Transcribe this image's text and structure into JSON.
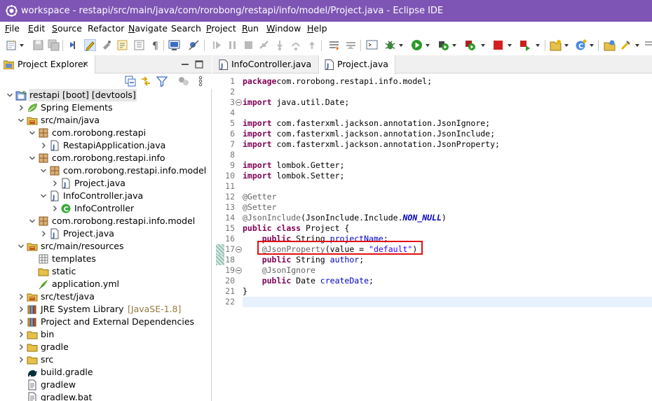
{
  "window": {
    "title": "workspace - restapi/src/main/java/com/rorobong/restapi/info/model/Project.java - Eclipse IDE"
  },
  "menu": [
    {
      "label": "File",
      "mnemonic": "F",
      "rest": "ile"
    },
    {
      "label": "Edit",
      "mnemonic": "E",
      "rest": "dit"
    },
    {
      "label": "Source",
      "mnemonic": "S",
      "rest": "ource"
    },
    {
      "label": "Refactor",
      "mnemonic": "",
      "rest": "Refactor"
    },
    {
      "label": "Navigate",
      "mnemonic": "N",
      "rest": "avigate"
    },
    {
      "label": "Search",
      "mnemonic": "",
      "rest": "Search"
    },
    {
      "label": "Project",
      "mnemonic": "P",
      "rest": "roject"
    },
    {
      "label": "Run",
      "mnemonic": "R",
      "rest": "un"
    },
    {
      "label": "Window",
      "mnemonic": "W",
      "rest": "indow"
    },
    {
      "label": "Help",
      "mnemonic": "H",
      "rest": "elp"
    }
  ],
  "explorer": {
    "tab_label": "Project Explorer",
    "tab_close": "✕",
    "tree": [
      {
        "label": "restapi [boot] [devtools]",
        "icon": "project-icon",
        "expanded": true,
        "selected": true
      },
      {
        "label": "Spring Elements",
        "icon": "spring-icon",
        "expanded": false
      },
      {
        "label": "src/main/java",
        "icon": "source-folder-icon",
        "expanded": true
      },
      {
        "label": "com.rorobong.restapi",
        "icon": "package-icon",
        "expanded": true
      },
      {
        "label": "RestapiApplication.java",
        "icon": "java-file-icon",
        "expanded": false
      },
      {
        "label": "com.rorobong.restapi.info",
        "icon": "package-icon",
        "expanded": true
      },
      {
        "label": "com.rorobong.restapi.info.model",
        "icon": "package-icon",
        "expanded": true
      },
      {
        "label": "Project.java",
        "icon": "java-file-icon",
        "expanded": false
      },
      {
        "label": "InfoController.java",
        "icon": "java-file-icon",
        "expanded": true
      },
      {
        "label": "InfoController",
        "icon": "class-icon",
        "expanded": false
      },
      {
        "label": "com.rorobong.restapi.info.model",
        "icon": "package-icon",
        "expanded": true
      },
      {
        "label": "Project.java",
        "icon": "java-file-icon",
        "expanded": false
      },
      {
        "label": "src/main/resources",
        "icon": "source-folder-icon",
        "expanded": true
      },
      {
        "label": "templates",
        "icon": "folder-grid-icon",
        "expanded": null
      },
      {
        "label": "static",
        "icon": "folder-icon",
        "expanded": null
      },
      {
        "label": "application.yml",
        "icon": "yaml-file-icon",
        "expanded": null
      },
      {
        "label": "src/test/java",
        "icon": "source-folder-icon",
        "expanded": false
      },
      {
        "label": "JRE System Library",
        "decoration": "[JavaSE-1.8]",
        "icon": "library-icon",
        "expanded": false
      },
      {
        "label": "Project and External Dependencies",
        "icon": "library-icon",
        "expanded": false
      },
      {
        "label": "bin",
        "icon": "folder-icon",
        "expanded": false
      },
      {
        "label": "gradle",
        "icon": "folder-icon",
        "expanded": false
      },
      {
        "label": "src",
        "icon": "folder-icon",
        "expanded": false
      },
      {
        "label": "build.gradle",
        "icon": "gradle-icon",
        "expanded": null
      },
      {
        "label": "gradlew",
        "icon": "text-file-icon",
        "expanded": null
      },
      {
        "label": "gradlew.bat",
        "icon": "text-file-icon",
        "expanded": null
      }
    ]
  },
  "editor": {
    "tabs": [
      {
        "label": "InfoController.java",
        "active": false
      },
      {
        "label": "Project.java",
        "active": true
      }
    ],
    "current_line": 22,
    "changed_lines": [
      17,
      18
    ],
    "folded_lines": [
      3,
      17,
      19
    ],
    "lines": [
      {
        "n": "1",
        "tokens": [
          [
            "kw",
            "package"
          ],
          [
            "",
            "com.rorobong.restapi.info.model;"
          ]
        ]
      },
      {
        "n": "2",
        "tokens": []
      },
      {
        "n": "3",
        "tokens": [
          [
            "kw",
            "import"
          ],
          [
            "",
            " java.util.Date;"
          ]
        ]
      },
      {
        "n": "4",
        "tokens": []
      },
      {
        "n": "5",
        "tokens": [
          [
            "kw",
            "import"
          ],
          [
            "",
            " com.fasterxml.jackson.annotation.JsonIgnore;"
          ]
        ]
      },
      {
        "n": "6",
        "tokens": [
          [
            "kw",
            "import"
          ],
          [
            "",
            " com.fasterxml.jackson.annotation.JsonInclude;"
          ]
        ]
      },
      {
        "n": "7",
        "tokens": [
          [
            "kw",
            "import"
          ],
          [
            "",
            " com.fasterxml.jackson.annotation.JsonProperty;"
          ]
        ]
      },
      {
        "n": "8",
        "tokens": []
      },
      {
        "n": "9",
        "tokens": [
          [
            "kw",
            "import"
          ],
          [
            "",
            " lombok.Getter;"
          ]
        ]
      },
      {
        "n": "10",
        "tokens": [
          [
            "kw",
            "import"
          ],
          [
            "",
            " lombok.Setter;"
          ]
        ]
      },
      {
        "n": "11",
        "tokens": []
      },
      {
        "n": "12",
        "tokens": [
          [
            "an",
            "@Getter"
          ]
        ]
      },
      {
        "n": "13",
        "tokens": [
          [
            "an",
            "@Setter"
          ]
        ]
      },
      {
        "n": "14",
        "tokens": [
          [
            "an",
            "@JsonInclude"
          ],
          [
            "",
            "(JsonInclude.Include."
          ],
          [
            "sf",
            "NON_NULL"
          ],
          [
            "",
            ")"
          ]
        ]
      },
      {
        "n": "15",
        "tokens": [
          [
            "kw",
            "public"
          ],
          [
            "",
            " "
          ],
          [
            "kw",
            "class"
          ],
          [
            "",
            " Project {"
          ]
        ]
      },
      {
        "n": "16",
        "tokens": [
          [
            "",
            "    "
          ],
          [
            "kw",
            "public"
          ],
          [
            "",
            " String "
          ],
          [
            "fd",
            "projectName"
          ],
          [
            "",
            ";"
          ]
        ]
      },
      {
        "n": "17",
        "tokens": [
          [
            "",
            "    "
          ],
          [
            "an",
            "@JsonProperty"
          ],
          [
            "",
            "(value = "
          ],
          [
            "st",
            "\"default\""
          ],
          [
            "",
            ")"
          ]
        ]
      },
      {
        "n": "18",
        "tokens": [
          [
            "",
            "    "
          ],
          [
            "kw",
            "public"
          ],
          [
            "",
            " String "
          ],
          [
            "fd",
            "author"
          ],
          [
            "",
            ";"
          ]
        ]
      },
      {
        "n": "19",
        "tokens": [
          [
            "",
            "    "
          ],
          [
            "an",
            "@JsonIgnore"
          ]
        ]
      },
      {
        "n": "20",
        "tokens": [
          [
            "",
            "    "
          ],
          [
            "kw",
            "public"
          ],
          [
            "",
            " Date "
          ],
          [
            "fd",
            "createDate"
          ],
          [
            "",
            ";"
          ]
        ]
      },
      {
        "n": "21",
        "tokens": [
          [
            "",
            "}"
          ]
        ]
      },
      {
        "n": "22",
        "tokens": []
      }
    ]
  }
}
